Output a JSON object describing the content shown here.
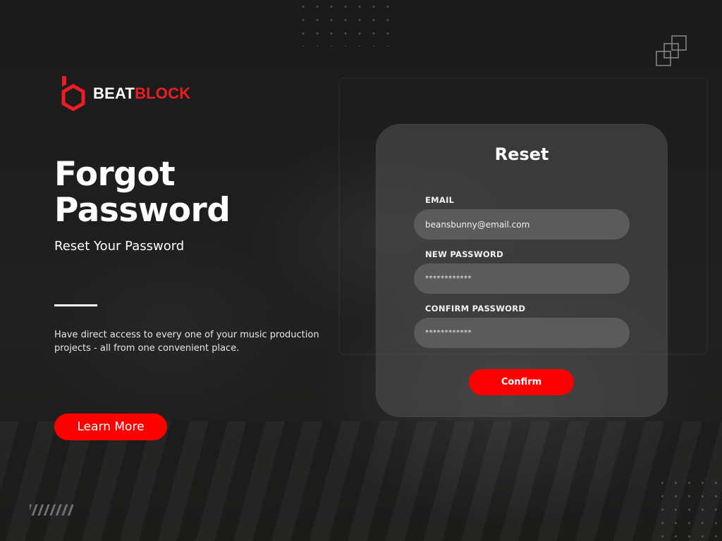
{
  "brand": {
    "name_part1": "BEAT",
    "name_part2": "BLOCK",
    "accent_color": "#ee1c24",
    "logo_icon": "hexagon-b-icon"
  },
  "hero": {
    "headline_line1": "Forgot",
    "headline_line2": "Password",
    "subheading": "Reset Your Password",
    "description": "Have direct access to every one of your music production projects - all from one convenient place.",
    "learn_more_label": "Learn More"
  },
  "reset_form": {
    "title": "Reset",
    "email_label": "EMAIL",
    "email_value": "beansbunny@email.com",
    "new_password_label": "NEW PASSWORD",
    "new_password_value": "************",
    "confirm_password_label": "CONFIRM PASSWORD",
    "confirm_password_value": "************",
    "confirm_label": "Confirm"
  },
  "colors": {
    "background": "#1b1b1b",
    "button": "#ff0000",
    "card": "#525252",
    "field": "#5b5b5b"
  }
}
